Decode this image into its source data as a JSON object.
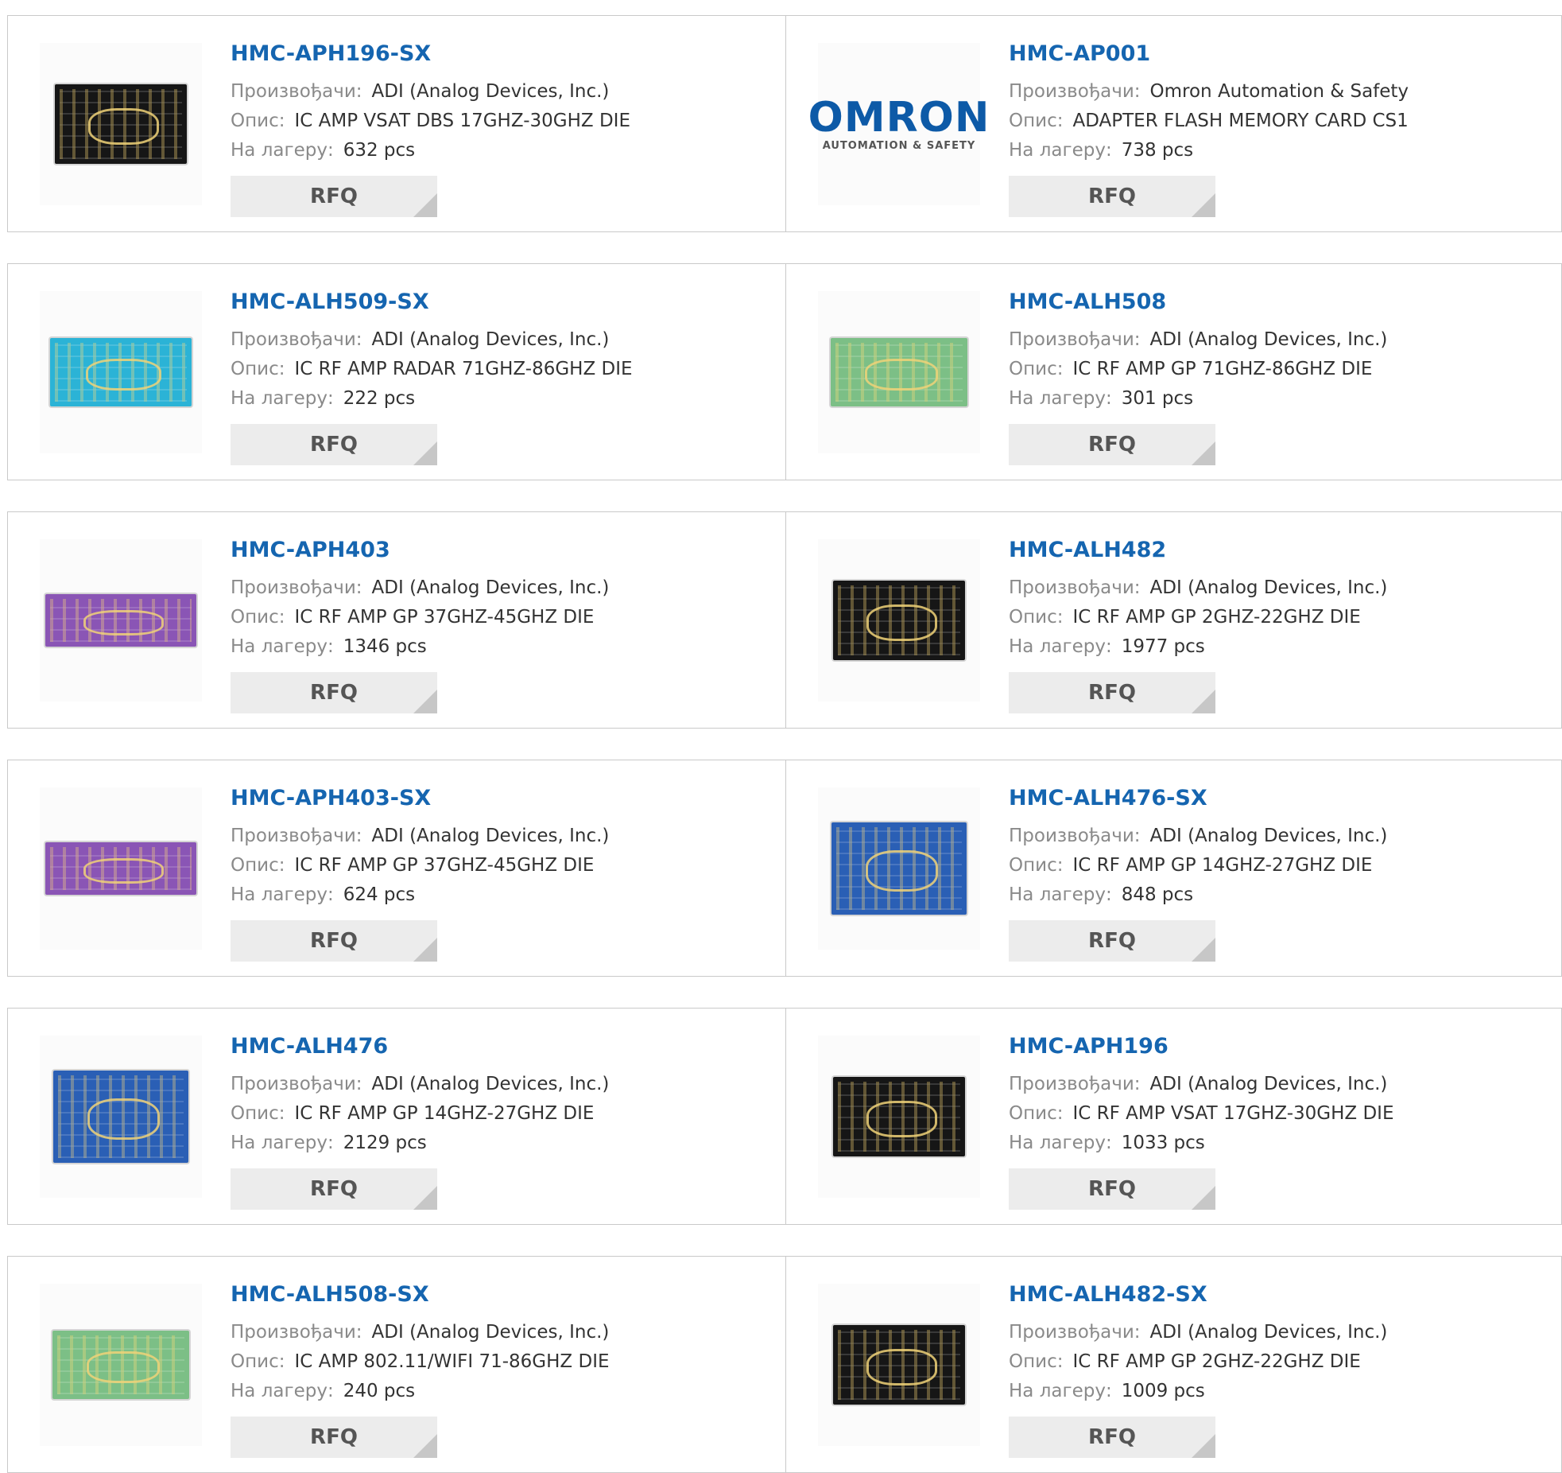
{
  "labels": {
    "manufacturer": "Произвођачи:",
    "description": "Опис:",
    "stock": "На лагеру:",
    "rfq": "RFQ"
  },
  "logos": {
    "omron_word": "OMRON",
    "omron_sub": "AUTOMATION & SAFETY"
  },
  "products": [
    {
      "part": "HMC-APH196-SX",
      "manufacturer": "ADI (Analog Devices, Inc.)",
      "description": "IC AMP VSAT DBS 17GHZ-30GHZ DIE",
      "stock": "632 pcs",
      "image": "die-black"
    },
    {
      "part": "HMC-AP001",
      "manufacturer": "Omron Automation & Safety",
      "description": "ADAPTER FLASH MEMORY CARD CS1",
      "stock": "738 pcs",
      "image": "omron-logo"
    },
    {
      "part": "HMC-ALH509-SX",
      "manufacturer": "ADI (Analog Devices, Inc.)",
      "description": "IC RF AMP RADAR 71GHZ-86GHZ DIE",
      "stock": "222 pcs",
      "image": "die-cyan"
    },
    {
      "part": "HMC-ALH508",
      "manufacturer": "ADI (Analog Devices, Inc.)",
      "description": "IC RF AMP GP 71GHZ-86GHZ DIE",
      "stock": "301 pcs",
      "image": "die-green"
    },
    {
      "part": "HMC-APH403",
      "manufacturer": "ADI (Analog Devices, Inc.)",
      "description": "IC RF AMP GP 37GHZ-45GHZ DIE",
      "stock": "1346 pcs",
      "image": "die-purple"
    },
    {
      "part": "HMC-ALH482",
      "manufacturer": "ADI (Analog Devices, Inc.)",
      "description": "IC RF AMP GP 2GHZ-22GHZ DIE",
      "stock": "1977 pcs",
      "image": "die-black"
    },
    {
      "part": "HMC-APH403-SX",
      "manufacturer": "ADI (Analog Devices, Inc.)",
      "description": "IC RF AMP GP 37GHZ-45GHZ DIE",
      "stock": "624 pcs",
      "image": "die-purple"
    },
    {
      "part": "HMC-ALH476-SX",
      "manufacturer": "ADI (Analog Devices, Inc.)",
      "description": "IC RF AMP GP 14GHZ-27GHZ DIE",
      "stock": "848 pcs",
      "image": "die-blue"
    },
    {
      "part": "HMC-ALH476",
      "manufacturer": "ADI (Analog Devices, Inc.)",
      "description": "IC RF AMP GP 14GHZ-27GHZ DIE",
      "stock": "2129 pcs",
      "image": "die-blue"
    },
    {
      "part": "HMC-APH196",
      "manufacturer": "ADI (Analog Devices, Inc.)",
      "description": "IC RF AMP VSAT 17GHZ-30GHZ DIE",
      "stock": "1033 pcs",
      "image": "die-black"
    },
    {
      "part": "HMC-ALH508-SX",
      "manufacturer": "ADI (Analog Devices, Inc.)",
      "description": "IC AMP 802.11/WIFI 71-86GHZ DIE",
      "stock": "240 pcs",
      "image": "die-green"
    },
    {
      "part": "HMC-ALH482-SX",
      "manufacturer": "ADI (Analog Devices, Inc.)",
      "description": "IC RF AMP GP 2GHZ-22GHZ DIE",
      "stock": "1009 pcs",
      "image": "die-black"
    }
  ],
  "colors": {
    "link": "#1565b0",
    "die-black": "#161616",
    "die-cyan": "#2bb3d6",
    "die-green": "#7cbf86",
    "die-purple": "#8a55b5",
    "die-blue": "#2a5fb5",
    "omron": "#0d5aa7"
  }
}
